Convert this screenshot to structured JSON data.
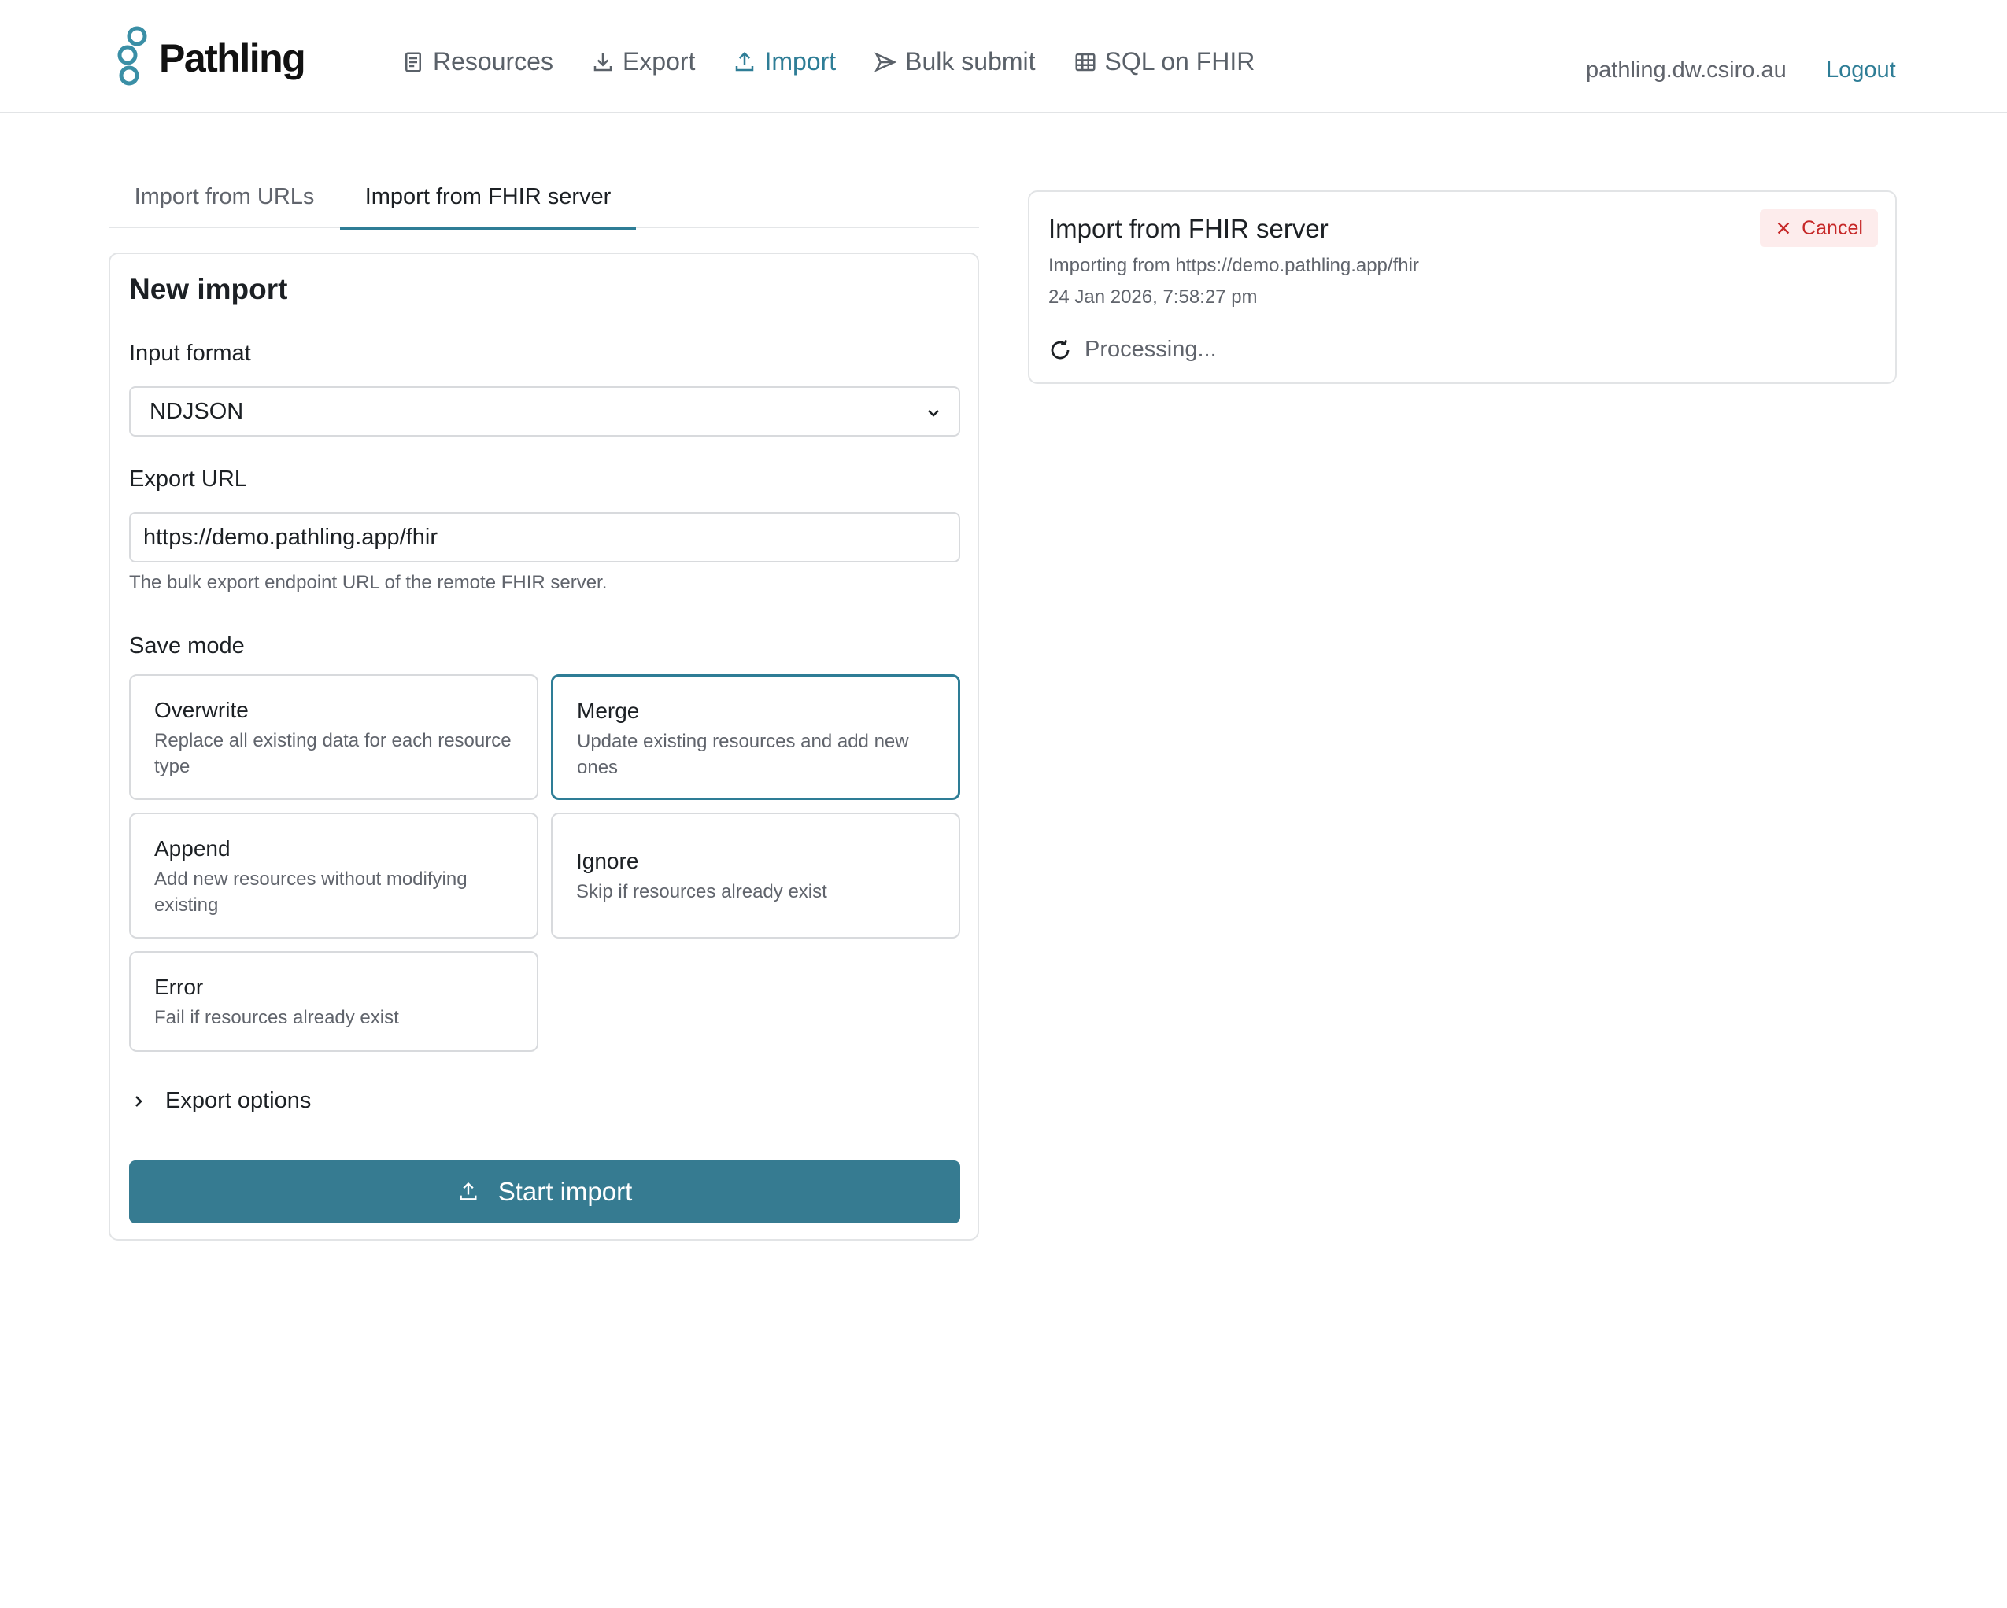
{
  "header": {
    "brand": "Pathling",
    "nav": [
      {
        "label": "Resources",
        "icon": "document-icon"
      },
      {
        "label": "Export",
        "icon": "download-icon"
      },
      {
        "label": "Import",
        "icon": "upload-icon",
        "active": true
      },
      {
        "label": "Bulk submit",
        "icon": "send-icon"
      },
      {
        "label": "SQL on FHIR",
        "icon": "table-icon"
      }
    ],
    "host": "pathling.dw.csiro.au",
    "logout": "Logout"
  },
  "tabs": [
    "Import from URLs",
    "Import from FHIR server"
  ],
  "form": {
    "title": "New import",
    "input_format_label": "Input format",
    "input_format_value": "NDJSON",
    "export_url_label": "Export URL",
    "export_url_value": "https://demo.pathling.app/fhir",
    "export_url_help": "The bulk export endpoint URL of the remote FHIR server.",
    "save_mode_label": "Save mode",
    "save_modes": [
      {
        "title": "Overwrite",
        "desc": "Replace all existing data for each resource type"
      },
      {
        "title": "Merge",
        "desc": "Update existing resources and add new ones",
        "selected": true
      },
      {
        "title": "Append",
        "desc": "Add new resources without modifying existing"
      },
      {
        "title": "Ignore",
        "desc": "Skip if resources already exist"
      },
      {
        "title": "Error",
        "desc": "Fail if resources already exist"
      }
    ],
    "export_options_label": "Export options",
    "submit_label": "Start import"
  },
  "status": {
    "title": "Import from FHIR server",
    "source": "Importing from https://demo.pathling.app/fhir",
    "timestamp": "24 Jan 2026, 7:58:27 pm",
    "cancel_label": "Cancel",
    "state": "Processing..."
  },
  "colors": {
    "accent": "#2e7d96",
    "primary_button": "#367b91",
    "danger": "#c62828",
    "danger_bg": "#fdecec"
  }
}
